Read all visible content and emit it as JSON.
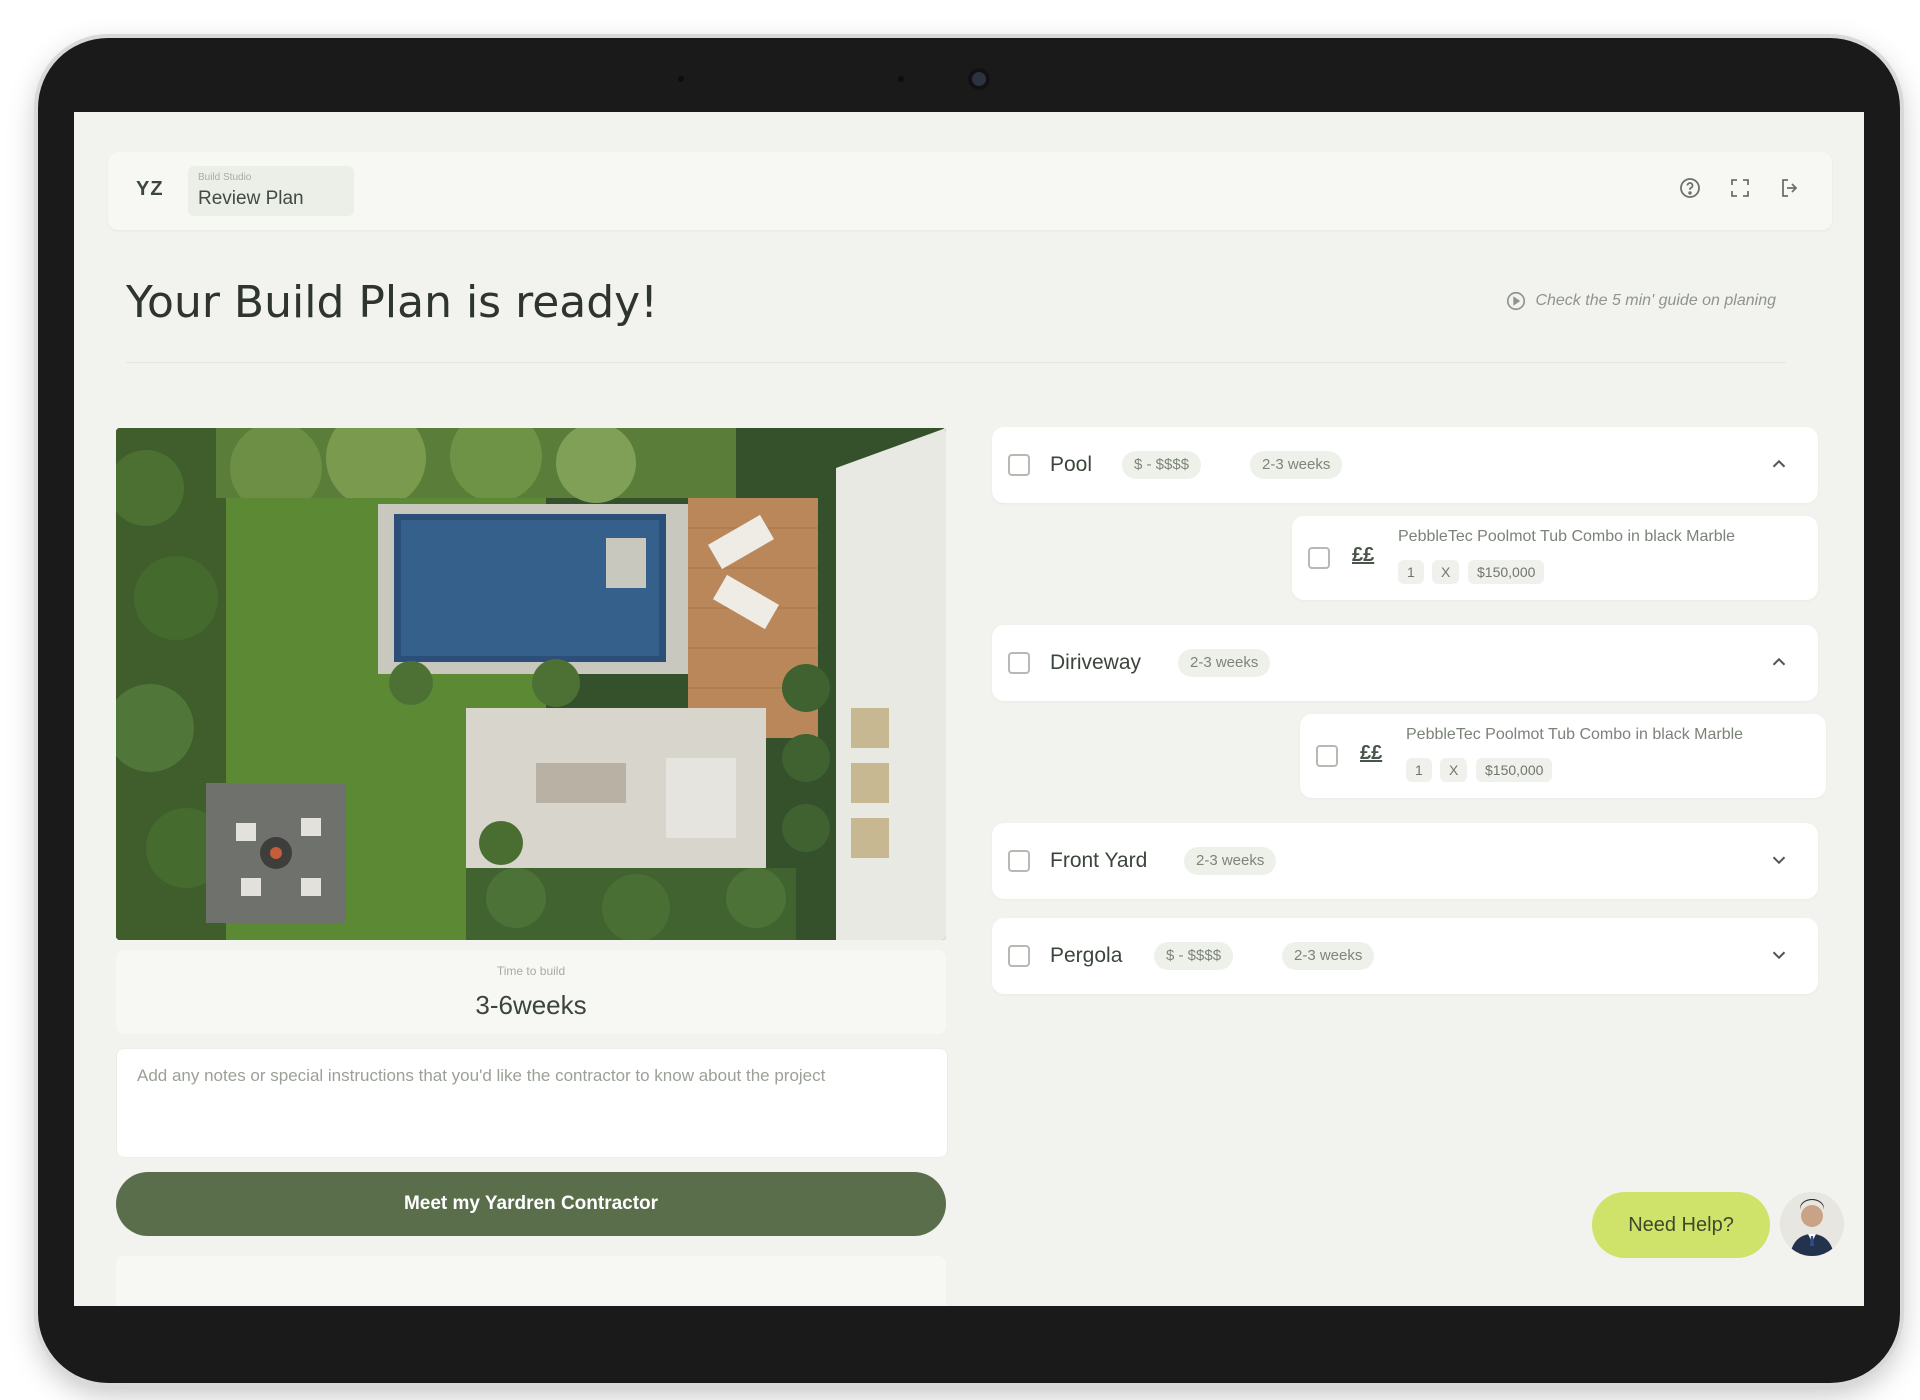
{
  "header": {
    "logo": "YZ",
    "crumb_small": "Build Studio",
    "crumb_title": "Review Plan",
    "icons": [
      "help-circle-icon",
      "expand-icon",
      "logout-icon"
    ]
  },
  "page": {
    "title": "Your Build Plan is ready!",
    "guide_link": "Check the 5 min' guide on planing"
  },
  "plan": {
    "time_label": "Time to build",
    "time_value": "3-6weeks",
    "notes_placeholder": "Add any notes or special instructions that you'd like the contractor to know about the project",
    "cta_label": "Meet my Yardren Contractor"
  },
  "sections": [
    {
      "title": "Pool",
      "price": "$ - $$$$",
      "duration": "2-3 weeks",
      "expanded": true,
      "item": {
        "cost_icon": "££",
        "name": "PebbleTec Poolmot Tub Combo in black Marble",
        "qty": "1",
        "times": "X",
        "price": "$150,000"
      }
    },
    {
      "title": "Diriveway",
      "duration": "2-3 weeks",
      "expanded": true,
      "item": {
        "cost_icon": "££",
        "name": "PebbleTec Poolmot Tub Combo in black Marble",
        "qty": "1",
        "times": "X",
        "price": "$150,000"
      }
    },
    {
      "title": "Front Yard",
      "duration": "2-3 weeks",
      "expanded": false
    },
    {
      "title": "Pergola",
      "price": "$ - $$$$",
      "duration": "2-3 weeks",
      "expanded": false
    }
  ],
  "help": {
    "label": "Need Help?"
  },
  "colors": {
    "accent": "#5b6e4c",
    "help": "#cfe36a",
    "background": "#f2f3ee"
  }
}
